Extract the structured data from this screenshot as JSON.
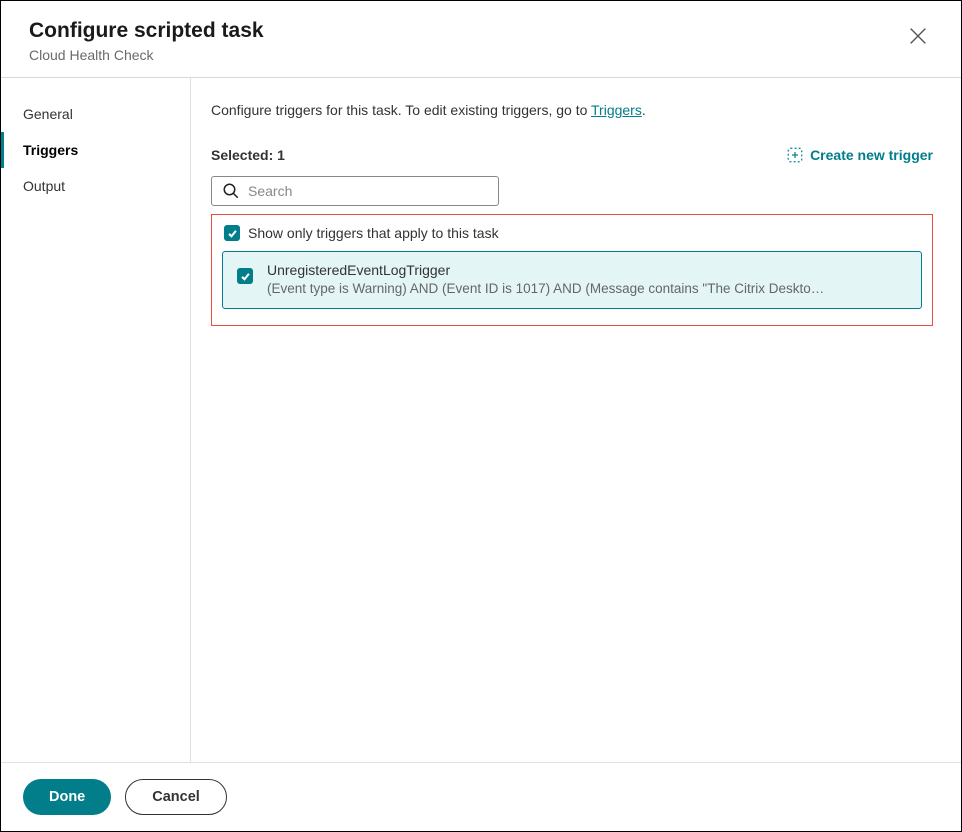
{
  "header": {
    "title": "Configure scripted task",
    "subtitle": "Cloud Health Check"
  },
  "sidebar": {
    "items": [
      {
        "label": "General"
      },
      {
        "label": "Triggers"
      },
      {
        "label": "Output"
      }
    ]
  },
  "main": {
    "instruction_prefix": "Configure triggers for this task. To edit existing triggers, go to ",
    "instruction_link": "Triggers",
    "instruction_suffix": ".",
    "selected_label": "Selected: 1",
    "create_label": "Create new trigger",
    "search_placeholder": "Search",
    "filter_label": "Show only triggers that apply to this task",
    "triggers": [
      {
        "name": "UnregisteredEventLogTrigger",
        "desc": "(Event type is Warning) AND (Event ID is 1017) AND (Message contains \"The Citrix Desktop Service fai..."
      }
    ]
  },
  "footer": {
    "done": "Done",
    "cancel": "Cancel"
  }
}
